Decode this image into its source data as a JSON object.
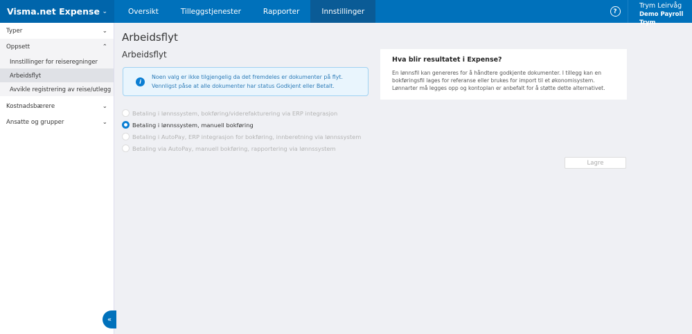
{
  "app": {
    "title": "Visma.net Expense"
  },
  "nav": {
    "tabs": [
      {
        "label": "Oversikt"
      },
      {
        "label": "Tilleggstjenester"
      },
      {
        "label": "Rapporter"
      },
      {
        "label": "Innstillinger"
      }
    ]
  },
  "user": {
    "name": "Trym Leirvåg",
    "org": "Demo Payroll Trym"
  },
  "sidebar": {
    "typer": "Typer",
    "oppsett": "Oppsett",
    "sub": [
      "Innstillinger for reiseregninger",
      "Arbeidsflyt",
      "Avvikle registrering av reise/utlegg"
    ],
    "kostnad": "Kostnadsbærere",
    "ansatte": "Ansatte og grupper"
  },
  "page": {
    "title": "Arbeidsflyt",
    "section": "Arbeidsflyt",
    "info": "Noen valg er ikke tilgjengelig da det fremdeles er dokumenter på flyt. Vennligst påse at alle dokumenter har status Godkjent eller Betalt.",
    "options": [
      "Betaling i lønnssystem, bokføring/viderefakturering via ERP integrasjon",
      "Betaling i lønnssystem, manuell bokføring",
      "Betaling i AutoPay, ERP integrasjon for bokføring, innberetning via lønnssystem",
      "Betaling via AutoPay, manuell bokføring, rapportering via lønnssystem"
    ],
    "save": "Lagre"
  },
  "card": {
    "title": "Hva blir resultatet i Expense?",
    "text": "En lønnsfil kan genereres for å håndtere godkjente dokumenter. I tillegg kan en bokføringsfil lages for referanse eller brukes for import til et økonomisystem. Lønnarter må legges opp og kontoplan er anbefalt for å støtte dette alternativet."
  }
}
